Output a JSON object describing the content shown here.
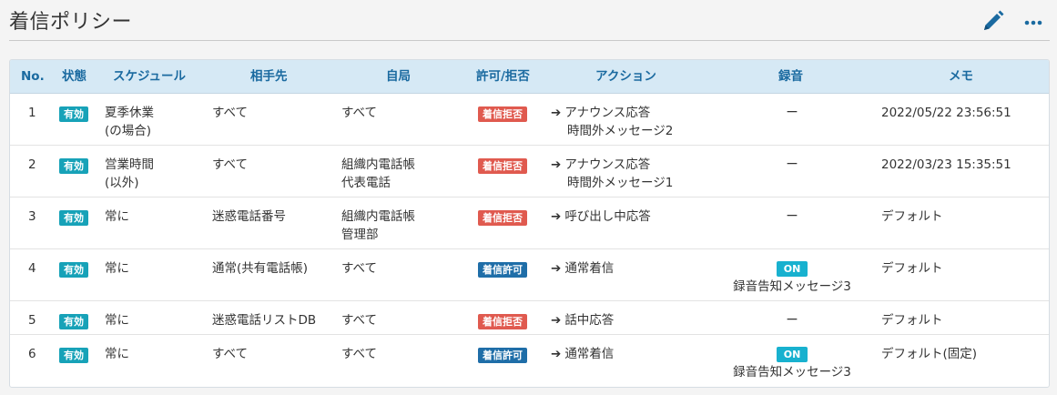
{
  "page": {
    "title": "着信ポリシー"
  },
  "icons": {
    "edit": "pencil-icon",
    "more": "ellipsis-icon"
  },
  "colors": {
    "accent": "#1a6aa0",
    "status": "#17a2b8",
    "reject": "#e05a4f",
    "allow": "#1f6ea8",
    "on": "#18b1cf"
  },
  "table": {
    "headers": {
      "no": "No.",
      "status": "状態",
      "schedule": "スケジュール",
      "partner": "相手先",
      "own": "自局",
      "permit": "許可/拒否",
      "action": "アクション",
      "recording": "録音",
      "memo": "メモ"
    },
    "rows": [
      {
        "no": "1",
        "status": "有効",
        "schedule1": "夏季休業",
        "schedule2": "(の場合)",
        "partner1": "すべて",
        "partner2": "",
        "own1": "すべて",
        "own2": "",
        "permit": "着信拒否",
        "action1": "アナウンス応答",
        "action2": "時間外メッセージ2",
        "rec_on": "",
        "rec_text": "ー",
        "memo": "2022/05/22 23:56:51"
      },
      {
        "no": "2",
        "status": "有効",
        "schedule1": "営業時間",
        "schedule2": "(以外)",
        "partner1": "すべて",
        "partner2": "",
        "own1": "組織内電話帳",
        "own2": "代表電話",
        "permit": "着信拒否",
        "action1": "アナウンス応答",
        "action2": "時間外メッセージ1",
        "rec_on": "",
        "rec_text": "ー",
        "memo": "2022/03/23 15:35:51"
      },
      {
        "no": "3",
        "status": "有効",
        "schedule1": "常に",
        "schedule2": "",
        "partner1": "迷惑電話番号",
        "partner2": "",
        "own1": "組織内電話帳",
        "own2": "管理部",
        "permit": "着信拒否",
        "action1": "呼び出し中応答",
        "action2": "",
        "rec_on": "",
        "rec_text": "ー",
        "memo": "デフォルト"
      },
      {
        "no": "4",
        "status": "有効",
        "schedule1": "常に",
        "schedule2": "",
        "partner1": "通常(共有電話帳)",
        "partner2": "",
        "own1": "すべて",
        "own2": "",
        "permit": "着信許可",
        "action1": "通常着信",
        "action2": "",
        "rec_on": "ON",
        "rec_text": "録音告知メッセージ3",
        "memo": "デフォルト"
      },
      {
        "no": "5",
        "status": "有効",
        "schedule1": "常に",
        "schedule2": "",
        "partner1": "迷惑電話リストDB",
        "partner2": "",
        "own1": "すべて",
        "own2": "",
        "permit": "着信拒否",
        "action1": "話中応答",
        "action2": "",
        "rec_on": "",
        "rec_text": "ー",
        "memo": "デフォルト"
      },
      {
        "no": "6",
        "status": "有効",
        "schedule1": "常に",
        "schedule2": "",
        "partner1": "すべて",
        "partner2": "",
        "own1": "すべて",
        "own2": "",
        "permit": "着信許可",
        "action1": "通常着信",
        "action2": "",
        "rec_on": "ON",
        "rec_text": "録音告知メッセージ3",
        "memo": "デフォルト(固定)"
      }
    ]
  }
}
